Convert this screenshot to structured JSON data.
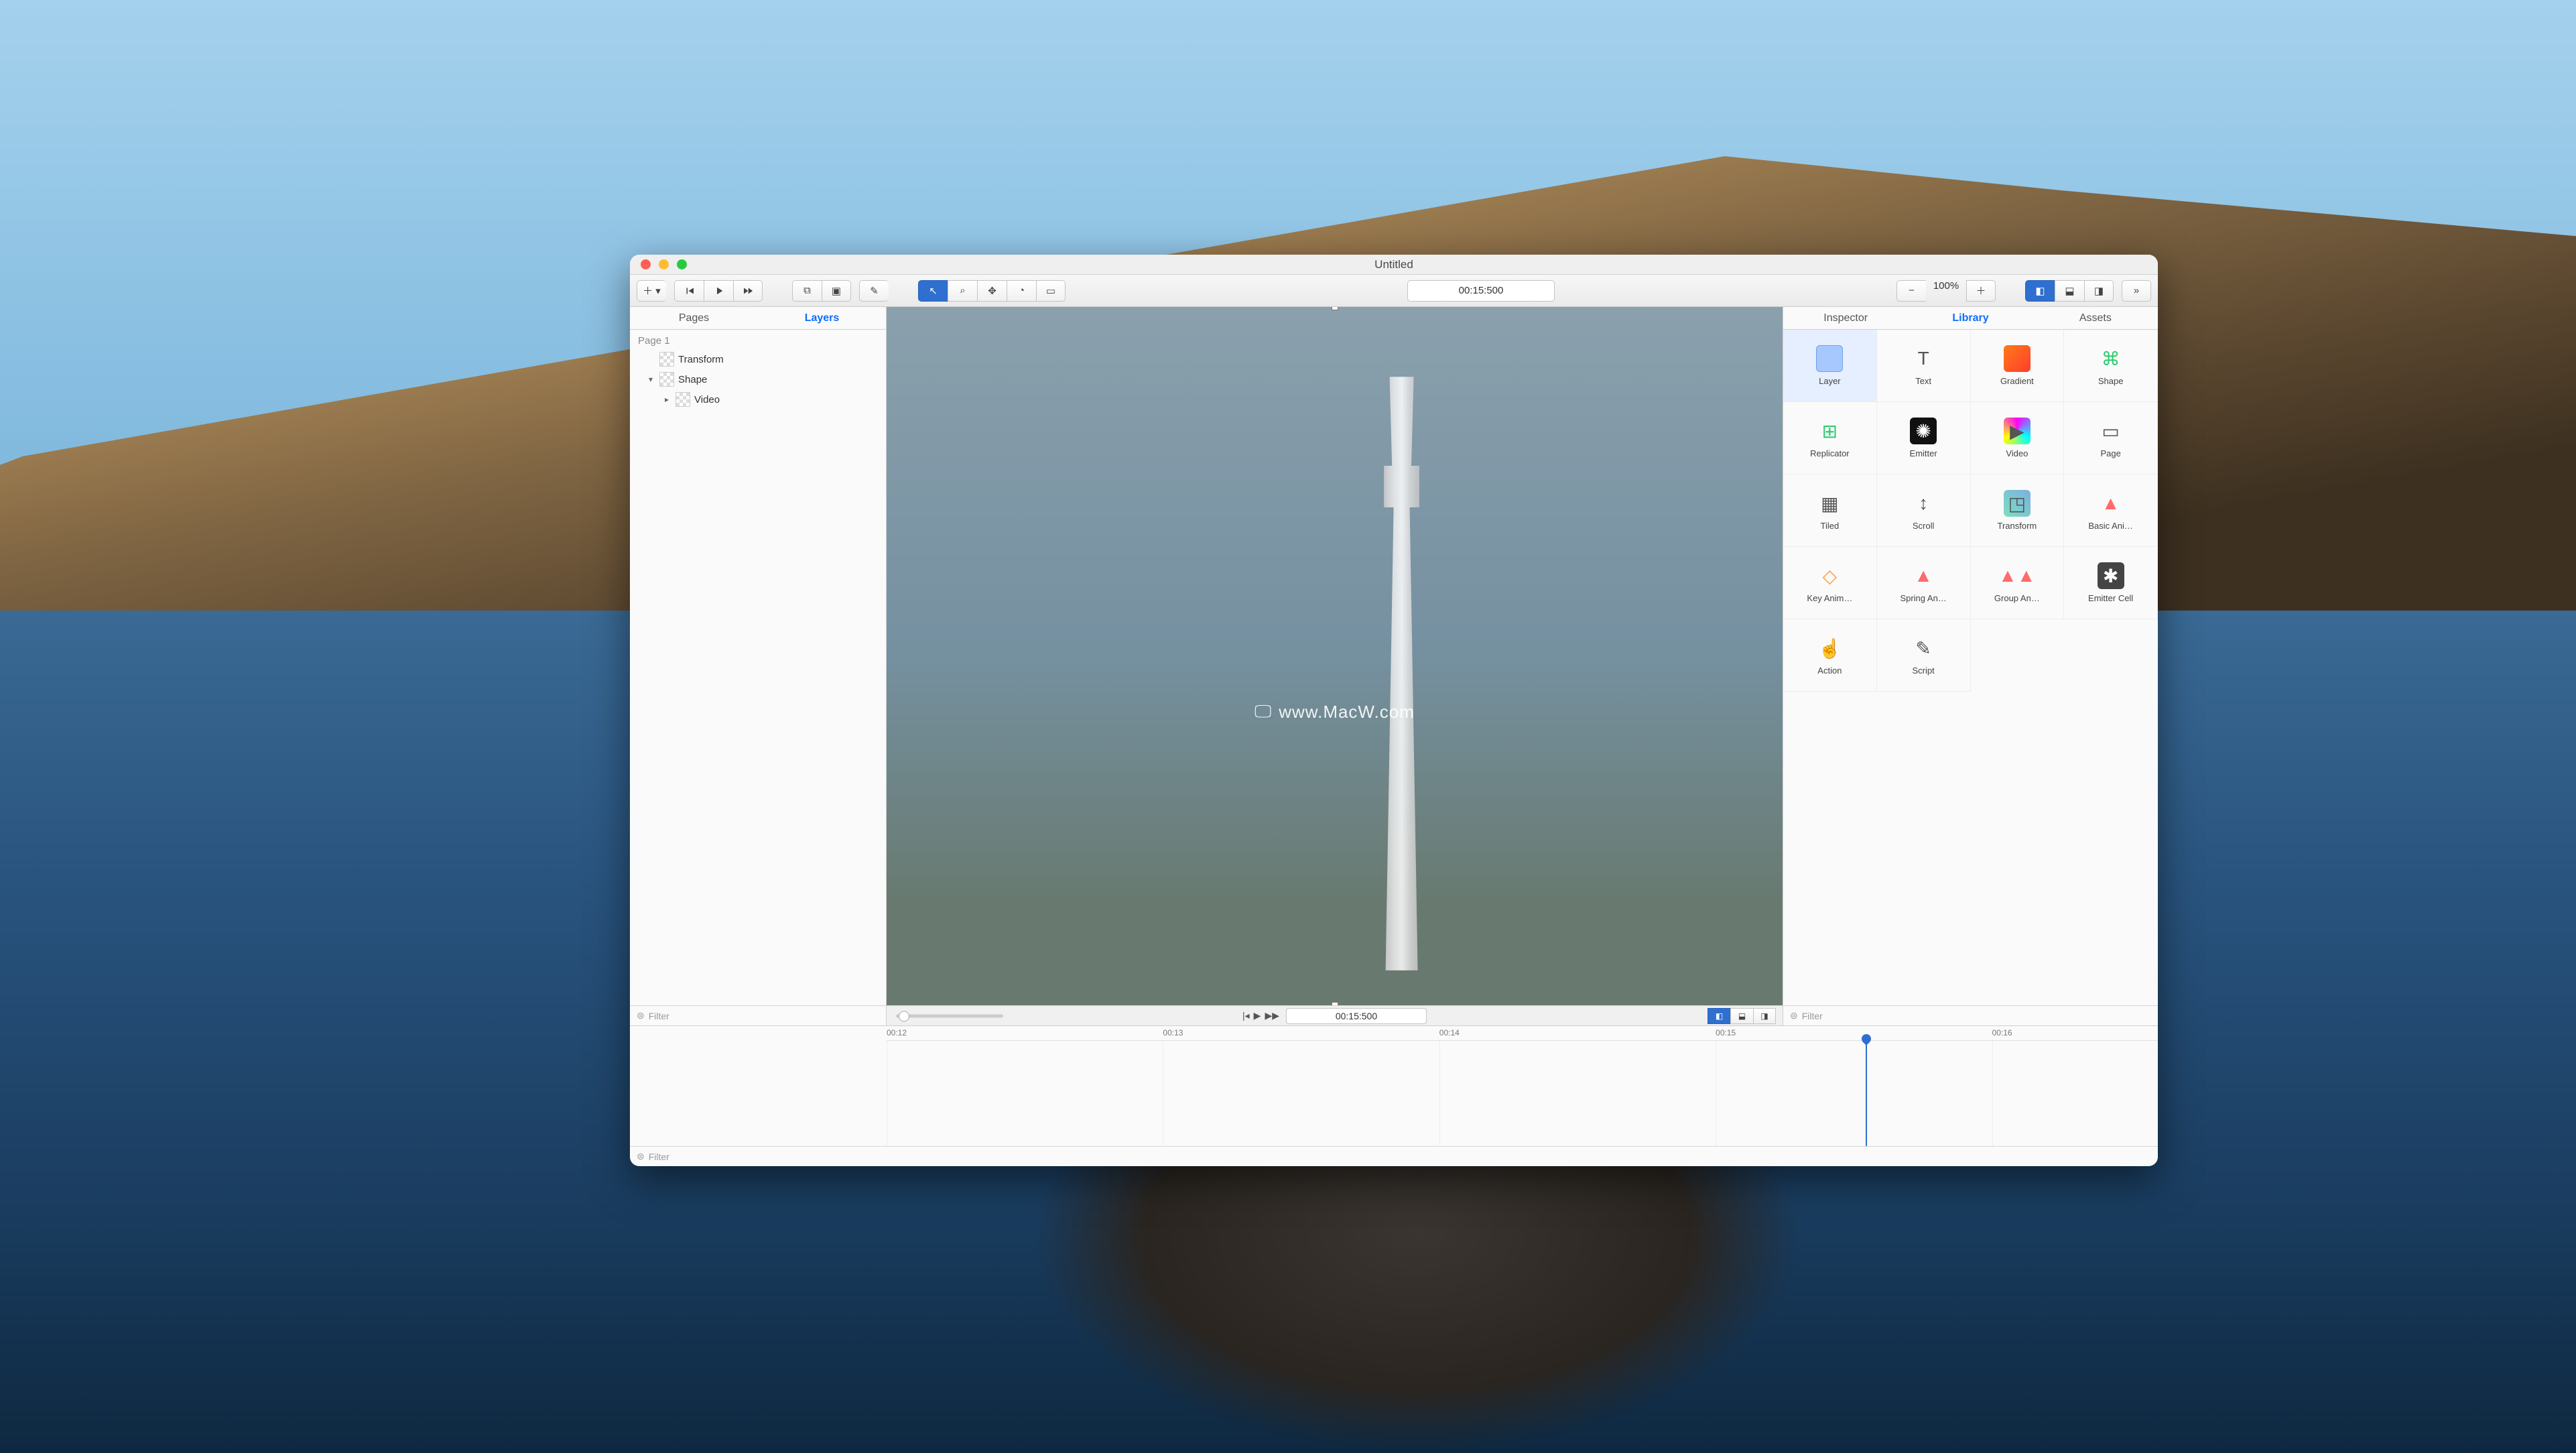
{
  "window": {
    "title": "Untitled"
  },
  "toolbar": {
    "time": "00:15:500",
    "zoom": "100%"
  },
  "left_panel": {
    "tabs": [
      "Pages",
      "Layers"
    ],
    "active_tab": "Layers",
    "page_header": "Page 1",
    "layers": [
      {
        "label": "Transform",
        "indent": 1
      },
      {
        "label": "Shape",
        "indent": 1,
        "expandable": true
      },
      {
        "label": "Video",
        "indent": 2,
        "expandable": true
      }
    ],
    "filter_placeholder": "Filter"
  },
  "canvas": {
    "watermark": "www.MacW.com"
  },
  "transport": {
    "time": "00:15:500"
  },
  "right_panel": {
    "tabs": [
      "Inspector",
      "Library",
      "Assets"
    ],
    "active_tab": "Library",
    "filter_placeholder": "Filter",
    "library": [
      {
        "label": "Layer",
        "selected": true,
        "color": "#8ab4ff"
      },
      {
        "label": "Text",
        "glyph": "T"
      },
      {
        "label": "Gradient",
        "gradient": "linear-gradient(135deg,#ff7a18,#ff3d2e)"
      },
      {
        "label": "Shape",
        "glyph": "⌘",
        "color": "#2ecc71"
      },
      {
        "label": "Replicator",
        "color": "#2ecc71",
        "glyph": "⊞"
      },
      {
        "label": "Emitter",
        "glyph": "✺",
        "bg": "#111",
        "color": "#fff"
      },
      {
        "label": "Video",
        "glyph": "▶",
        "gradient": "conic-gradient(#f0f,#0ff,#ff0,#f0f)"
      },
      {
        "label": "Page",
        "glyph": "▭"
      },
      {
        "label": "Tiled",
        "glyph": "▦"
      },
      {
        "label": "Scroll",
        "glyph": "↕"
      },
      {
        "label": "Transform",
        "glyph": "◳",
        "gradient": "linear-gradient(45deg,#7be0c0,#7bb0e0)"
      },
      {
        "label": "Basic Ani…",
        "glyph": "▲",
        "color": "#ff6b6b"
      },
      {
        "label": "Key Anim…",
        "glyph": "◇",
        "color": "#ff9f43"
      },
      {
        "label": "Spring An…",
        "glyph": "▲",
        "color": "#ff6b6b"
      },
      {
        "label": "Group An…",
        "glyph": "▲▲",
        "color": "#ff6b6b"
      },
      {
        "label": "Emitter Cell",
        "glyph": "✱",
        "bg": "#444",
        "color": "#fff"
      },
      {
        "label": "Action",
        "glyph": "☝"
      },
      {
        "label": "Script",
        "glyph": "✎"
      }
    ]
  },
  "timeline": {
    "ticks": [
      "00:12",
      "00:13",
      "00:14",
      "00:15",
      "00:16"
    ],
    "filter_placeholder": "Filter"
  }
}
